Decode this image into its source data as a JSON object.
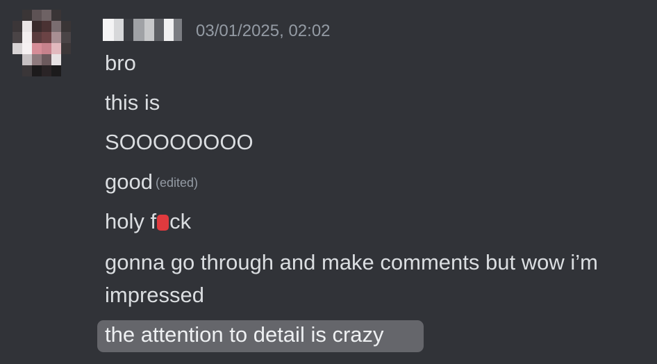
{
  "message": {
    "timestamp": "03/01/2025, 02:02",
    "lines": [
      {
        "text": "bro"
      },
      {
        "text": "this is"
      },
      {
        "text": "SOOOOOOOO"
      },
      {
        "text": "good",
        "edited_label": "(edited)"
      },
      {
        "text_before": "holy f",
        "text_after": "ck"
      },
      {
        "text": "gonna go through and make comments but wow i’m"
      },
      {
        "text": "impressed"
      },
      {
        "text": "the attention to detail is crazy"
      }
    ]
  },
  "colors": {
    "background": "#313338",
    "text": "#dbdee1",
    "muted": "#949ba4",
    "censor": "#e03a3e",
    "highlight": "#65666b"
  }
}
